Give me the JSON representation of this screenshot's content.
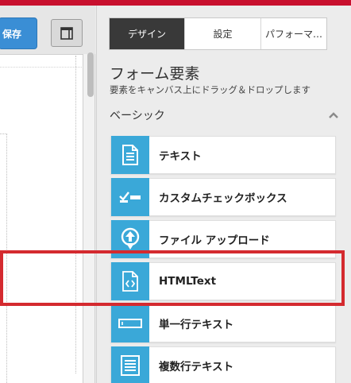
{
  "toolbar": {
    "save_label": "保存",
    "layout_icon": "layout-icon"
  },
  "tabs": [
    {
      "label": "デザイン",
      "active": true
    },
    {
      "label": "設定",
      "active": false
    },
    {
      "label": "パフォーマ…",
      "active": false
    }
  ],
  "section": {
    "title": "フォーム要素",
    "description": "要素をキャンバス上にドラッグ＆ドロップします",
    "group_label": "ベーシック"
  },
  "elements": [
    {
      "label": "テキスト",
      "icon": "document-icon"
    },
    {
      "label": "カスタムチェックボックス",
      "icon": "checkbox-icon"
    },
    {
      "label": "ファイル アップロード",
      "icon": "upload-icon"
    },
    {
      "label": "HTMLText",
      "icon": "code-file-icon",
      "highlighted": true
    },
    {
      "label": "単一行テキスト",
      "icon": "single-line-icon"
    },
    {
      "label": "複数行テキスト",
      "icon": "multi-line-icon"
    }
  ],
  "colors": {
    "accent": "#3aa8d8",
    "highlight": "#d42a2f",
    "brand_bar": "#c8102e",
    "save_button": "#3a8ed5"
  }
}
